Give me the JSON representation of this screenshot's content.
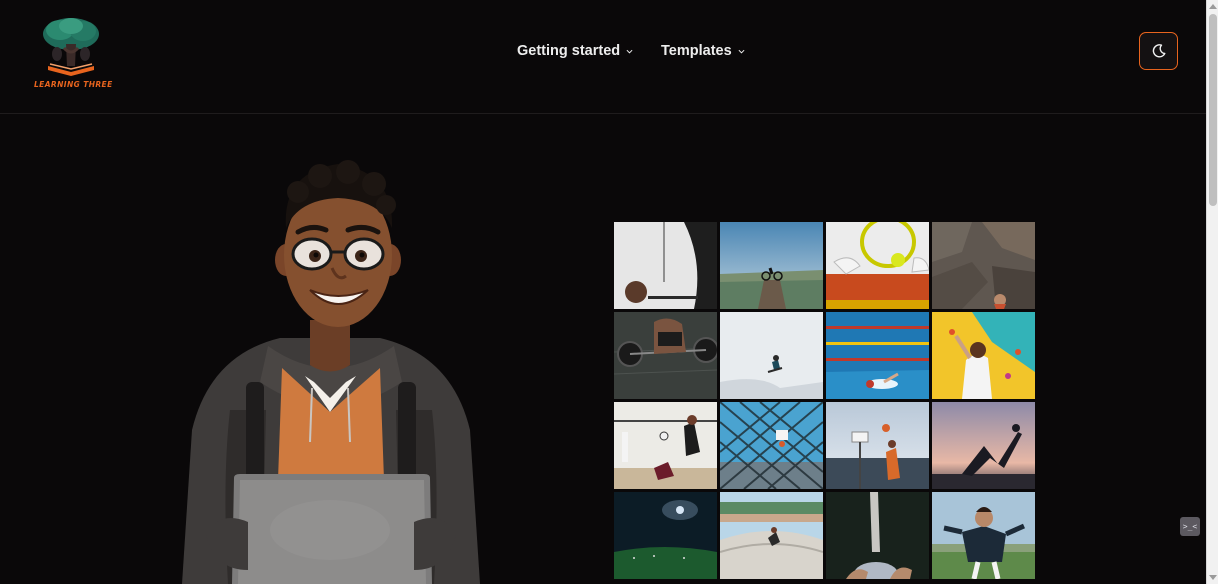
{
  "brand": {
    "logo_text": "LEARNING THREE",
    "accent_color": "#e8641e"
  },
  "nav": {
    "items": [
      {
        "label": "Getting started",
        "icon": "chevron-down-icon"
      },
      {
        "label": "Templates",
        "icon": "chevron-down-icon"
      }
    ]
  },
  "theme_toggle": {
    "icon": "moon-icon"
  },
  "hero": {
    "image": "student-with-laptop-illustration"
  },
  "gallery": {
    "tiles": [
      "basketball-hoop-photo",
      "mountain-bike-photo",
      "tennis-photo",
      "rock-climbing-photo",
      "weightlifting-photo",
      "snowboard-jump-photo",
      "swimming-photo",
      "climbing-wall-photo",
      "volleyball-photo",
      "fence-basketball-photo",
      "basketball-shot-photo",
      "yoga-photo",
      "stadium-night-photo",
      "skatepark-photo",
      "kick-photo",
      "soccer-player-photo"
    ]
  },
  "widget": {
    "label": ">_<"
  }
}
